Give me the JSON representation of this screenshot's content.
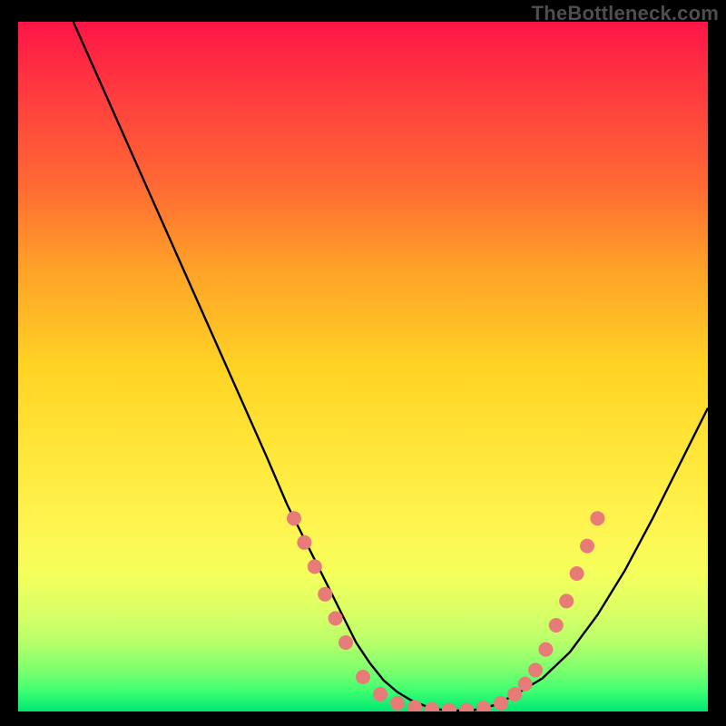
{
  "watermark": "TheBottleneck.com",
  "colors": {
    "background": "#000000",
    "curve": "#000000",
    "dot_fill": "#e77b77",
    "dot_stroke": "#c95d59",
    "gradient_top": "#ff1547",
    "gradient_bottom": "#00e874"
  },
  "chart_data": {
    "type": "line",
    "title": "",
    "xlabel": "",
    "ylabel": "",
    "xlim": [
      0,
      100
    ],
    "ylim": [
      0,
      100
    ],
    "series": [
      {
        "name": "bottleneck-curve",
        "x": [
          8,
          12,
          16,
          20,
          24,
          28,
          32,
          36,
          39,
          41,
          43,
          45,
          47,
          49,
          51,
          53,
          55,
          57,
          59,
          61,
          63,
          66,
          69,
          72,
          76,
          80,
          84,
          88,
          92,
          96,
          100
        ],
        "y": [
          100,
          91,
          82,
          73,
          64,
          55,
          46,
          37,
          30,
          26,
          22,
          18,
          14,
          10,
          7,
          4.5,
          2.8,
          1.6,
          0.8,
          0.3,
          0.1,
          0.2,
          0.9,
          2.4,
          4.8,
          8.6,
          14,
          20.5,
          28,
          36,
          44
        ]
      }
    ],
    "markers": {
      "name": "highlighted-range",
      "x_at_y": [
        [
          40,
          28
        ],
        [
          41.5,
          24.5
        ],
        [
          43,
          21
        ],
        [
          44.5,
          17
        ],
        [
          46,
          13.5
        ],
        [
          47.5,
          10
        ],
        [
          50,
          5
        ],
        [
          52.5,
          2.5
        ],
        [
          55,
          1.2
        ],
        [
          57.5,
          0.6
        ],
        [
          60,
          0.3
        ],
        [
          62.5,
          0.2
        ],
        [
          65,
          0.2
        ],
        [
          67.5,
          0.5
        ],
        [
          70,
          1.2
        ],
        [
          72,
          2.5
        ],
        [
          73.5,
          4
        ],
        [
          75,
          6
        ],
        [
          76.5,
          9
        ],
        [
          78,
          12.5
        ],
        [
          79.5,
          16
        ],
        [
          81,
          20
        ],
        [
          82.5,
          24
        ],
        [
          84,
          28
        ]
      ]
    }
  }
}
